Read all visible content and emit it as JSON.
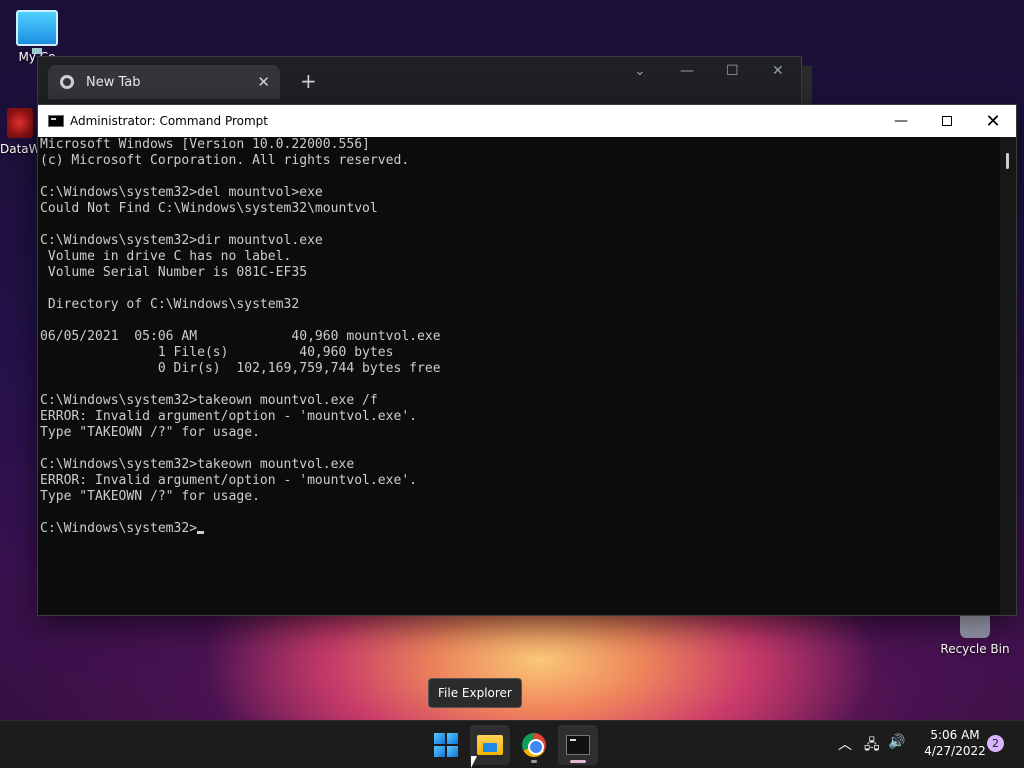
{
  "desktop": {
    "icons": [
      {
        "label": "My Co"
      },
      {
        "label": "DataW"
      },
      {
        "label": "Recycle Bin"
      }
    ]
  },
  "browser": {
    "tab_title": "New Tab",
    "tab_close": "✕",
    "new_tab": "+",
    "controls": [
      "⌄",
      "—",
      "☐",
      "✕"
    ]
  },
  "cmd": {
    "title": "Administrator: Command Prompt",
    "controls": {
      "minimize": "—",
      "close": "✕"
    },
    "output": "Microsoft Windows [Version 10.0.22000.556]\n(c) Microsoft Corporation. All rights reserved.\n\nC:\\Windows\\system32>del mountvol>exe\nCould Not Find C:\\Windows\\system32\\mountvol\n\nC:\\Windows\\system32>dir mountvol.exe\n Volume in drive C has no label.\n Volume Serial Number is 081C-EF35\n\n Directory of C:\\Windows\\system32\n\n06/05/2021  05:06 AM            40,960 mountvol.exe\n               1 File(s)         40,960 bytes\n               0 Dir(s)  102,169,759,744 bytes free\n\nC:\\Windows\\system32>takeown mountvol.exe /f\nERROR: Invalid argument/option - 'mountvol.exe'.\nType \"TAKEOWN /?\" for usage.\n\nC:\\Windows\\system32>takeown mountvol.exe\nERROR: Invalid argument/option - 'mountvol.exe'.\nType \"TAKEOWN /?\" for usage.\n\n",
    "prompt": "C:\\Windows\\system32>"
  },
  "tooltip": {
    "text": "File Explorer"
  },
  "taskbar": {
    "apps": [
      "Start",
      "File Explorer",
      "Google Chrome",
      "Command Prompt"
    ],
    "tray": {
      "chevron": "︿",
      "network": "🖧",
      "volume": "🔊",
      "time": "5:06 AM",
      "date": "4/27/2022",
      "notifications": "2"
    }
  }
}
